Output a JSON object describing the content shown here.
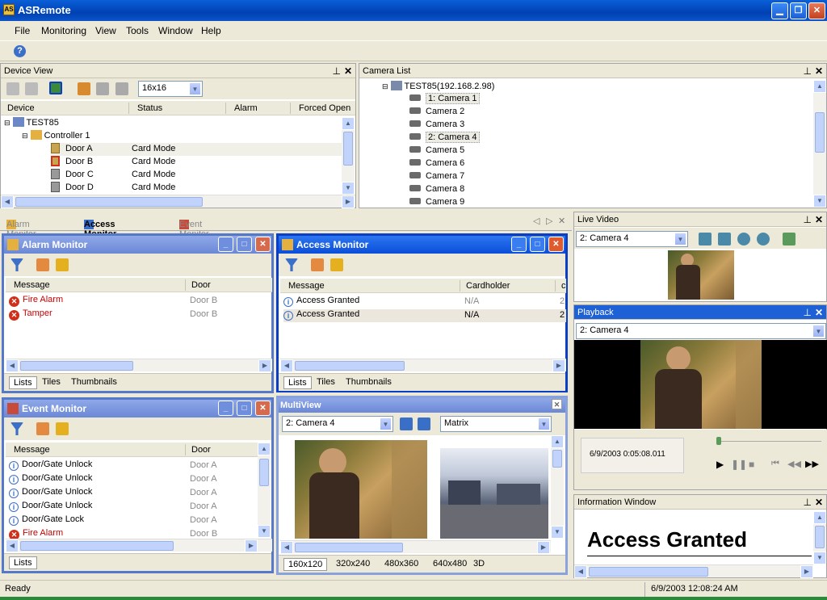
{
  "app": {
    "title": "ASRemote"
  },
  "menu": [
    "File",
    "Monitoring",
    "View",
    "Tools",
    "Window",
    "Help"
  ],
  "device_view": {
    "title": "Device View",
    "size_select": "16x16",
    "columns": [
      "Device",
      "Status",
      "Alarm",
      "Forced Open"
    ],
    "root": "TEST85",
    "controller": "Controller 1",
    "doors": [
      {
        "name": "Door A",
        "status": "Card Mode"
      },
      {
        "name": "Door B",
        "status": "Card Mode"
      },
      {
        "name": "Door C",
        "status": "Card Mode"
      },
      {
        "name": "Door D",
        "status": "Card Mode"
      }
    ]
  },
  "camera_list": {
    "title": "Camera List",
    "root": "TEST85(192.168.2.98)",
    "cameras": [
      "1: Camera 1",
      "Camera 2",
      "Camera 3",
      "2: Camera 4",
      "Camera 5",
      "Camera 6",
      "Camera 7",
      "Camera 8",
      "Camera 9"
    ]
  },
  "doc_tabs": [
    "Alarm Monitor",
    "Access Monitor",
    "Event Monitor"
  ],
  "alarm_monitor": {
    "title": "Alarm Monitor",
    "columns": [
      "Message",
      "Door"
    ],
    "rows": [
      {
        "msg": "Fire Alarm",
        "door": "Door B"
      },
      {
        "msg": "Tamper",
        "door": "Door B"
      }
    ],
    "tabs": [
      "Lists",
      "Tiles",
      "Thumbnails"
    ]
  },
  "access_monitor": {
    "title": "Access Monitor",
    "columns": [
      "Message",
      "Cardholder",
      "c"
    ],
    "rows": [
      {
        "msg": "Access Granted",
        "holder": "N/A",
        "extra": "2"
      },
      {
        "msg": "Access Granted",
        "holder": "N/A",
        "extra": "2"
      }
    ],
    "tabs": [
      "Lists",
      "Tiles",
      "Thumbnails"
    ]
  },
  "event_monitor": {
    "title": "Event Monitor",
    "columns": [
      "Message",
      "Door"
    ],
    "rows": [
      {
        "msg": "Door/Gate Unlock",
        "door": "Door A",
        "type": "info"
      },
      {
        "msg": "Door/Gate Unlock",
        "door": "Door A",
        "type": "info"
      },
      {
        "msg": "Door/Gate Unlock",
        "door": "Door A",
        "type": "info"
      },
      {
        "msg": "Door/Gate Unlock",
        "door": "Door A",
        "type": "info"
      },
      {
        "msg": "Door/Gate Lock",
        "door": "Door A",
        "type": "info"
      },
      {
        "msg": "Fire Alarm",
        "door": "Door B",
        "type": "alarm"
      }
    ],
    "tabs": [
      "Lists"
    ]
  },
  "multiview": {
    "title": "MultiView",
    "camera": "2: Camera 4",
    "layout": "Matrix",
    "sizes": [
      "160x120",
      "320x240",
      "480x360",
      "640x480",
      "3D"
    ]
  },
  "live_video": {
    "title": "Live Video",
    "camera": "2: Camera 4"
  },
  "playback": {
    "title": "Playback",
    "camera": "2: Camera 4",
    "timestamp": "6/9/2003 0:05:08.011"
  },
  "info_window": {
    "title": "Information Window",
    "message": "Access Granted"
  },
  "status": {
    "left": "Ready",
    "time": "6/9/2003 12:08:24 AM"
  },
  "colors": {
    "accent": "#1e61d6",
    "alarm": "#cc0000"
  }
}
